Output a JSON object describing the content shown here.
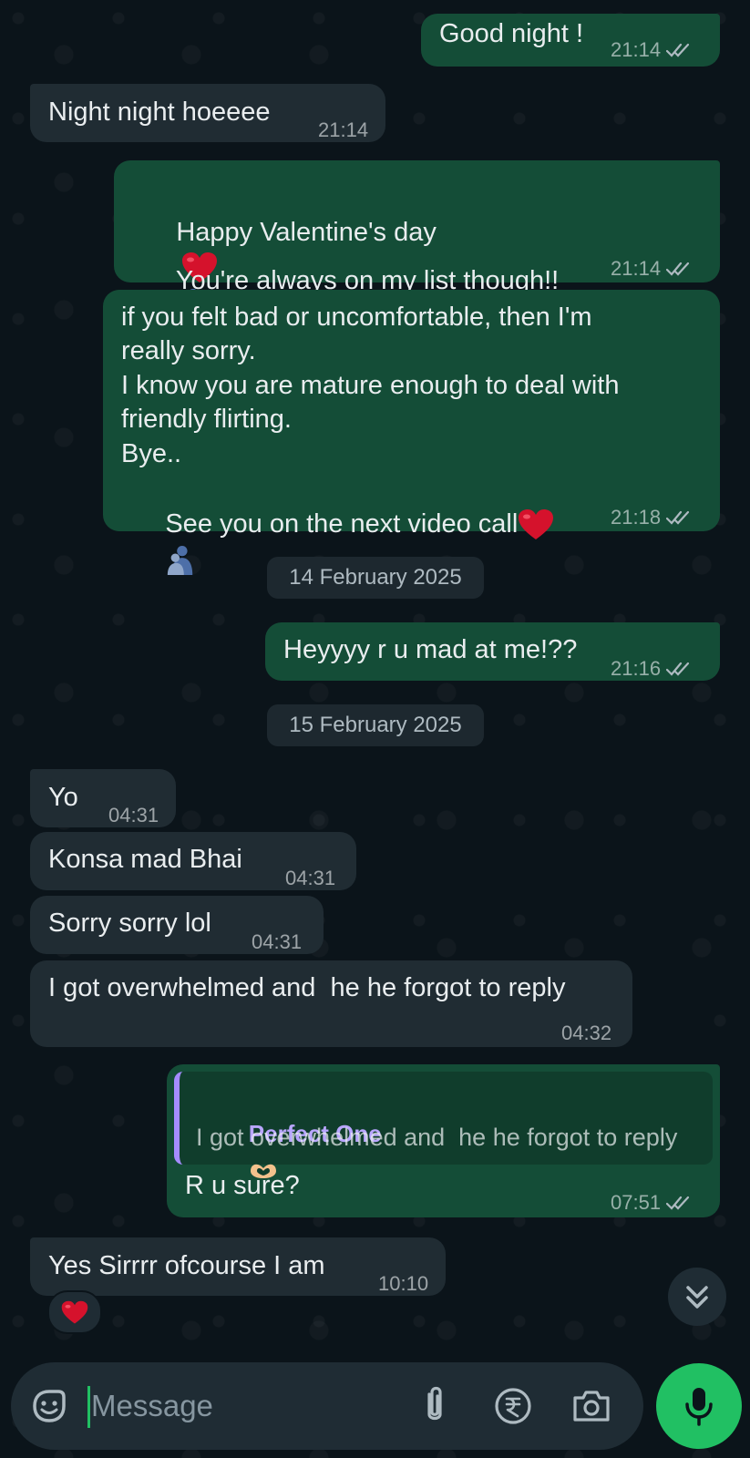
{
  "messages": [
    {
      "text": "Good night !",
      "time": "21:14",
      "dir": "out"
    },
    {
      "text": "Night night hoeeee",
      "time": "21:14",
      "dir": "in"
    },
    {
      "line1": "Happy Valentine's day",
      "line2": "You're always on my list though!!",
      "time": "21:14",
      "dir": "out"
    },
    {
      "lines": [
        "if you felt bad or uncomfortable, then I'm",
        "really sorry.",
        "I know you are mature enough to deal with",
        "friendly flirting.",
        "Bye..",
        "See you on the next video call"
      ],
      "time": "21:18",
      "dir": "out"
    },
    {
      "text": "Heyyyy r u mad at me!??",
      "time": "21:16",
      "dir": "out"
    },
    {
      "text": "Yo",
      "time": "04:31",
      "dir": "in"
    },
    {
      "text": "Konsa mad Bhai",
      "time": "04:31",
      "dir": "in"
    },
    {
      "text": "Sorry sorry lol",
      "time": "04:31",
      "dir": "in"
    },
    {
      "text": "I got overwhelmed and  he he forgot to reply",
      "time": "04:32",
      "dir": "in"
    },
    {
      "reply_name": "Perfect One",
      "reply_text": "I got overwhelmed and  he he forgot to reply",
      "text": "R u sure?",
      "time": "07:51",
      "dir": "out"
    },
    {
      "text": "Yes Sirrrr ofcourse I am",
      "time": "10:10",
      "dir": "in",
      "reaction": "heart"
    }
  ],
  "dates": {
    "first": "14 February 2025",
    "second": "15 February 2025"
  },
  "composer": {
    "placeholder": "Message"
  },
  "colors": {
    "outgoing": "#144d37",
    "incoming": "#202c33",
    "accent": "#21c063",
    "reply_bar": "#a58cff"
  },
  "icons": [
    "double-check-icon",
    "heart-emoji",
    "hug-emoji",
    "tongue-emoji",
    "sticker-icon",
    "attach-icon",
    "rupee-icon",
    "camera-icon",
    "mic-icon",
    "scroll-down-icon"
  ]
}
